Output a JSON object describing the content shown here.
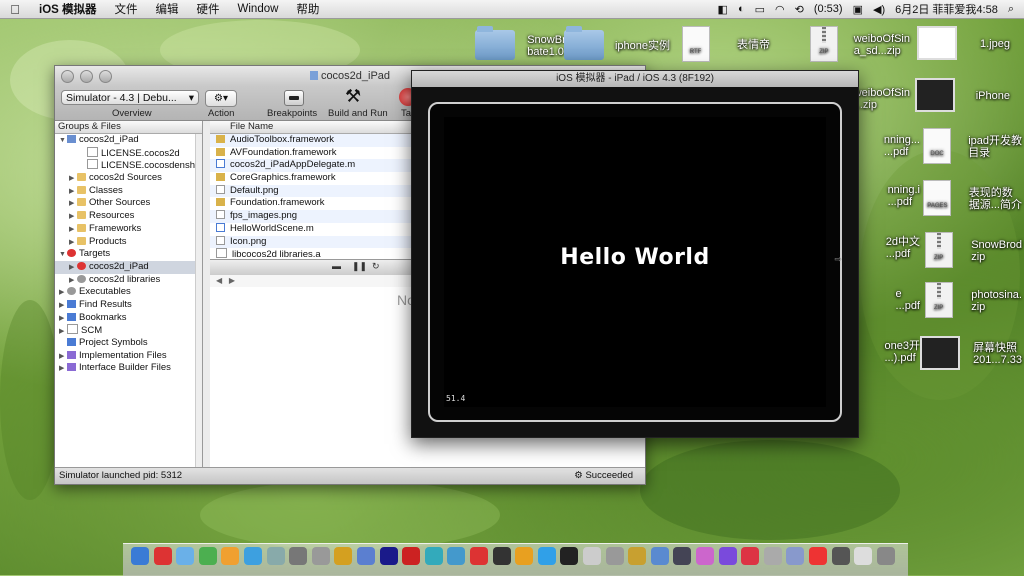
{
  "menubar": {
    "apple": "",
    "app_name": "iOS 模拟器",
    "items": [
      "文件",
      "编辑",
      "硬件",
      "Window",
      "帮助"
    ],
    "status": {
      "battery": "(0:53)",
      "clock": "6月2日 菲菲爱我4:58"
    }
  },
  "desktop_icons": [
    {
      "label": "SnowBrod\nbate1.0 2",
      "kind": "folder"
    },
    {
      "label": "iphone实例",
      "kind": "folder"
    },
    {
      "label": "表情帝",
      "kind": "doc",
      "badge": "RTF"
    },
    {
      "label": "weiboOfSin\na_sd...zip",
      "kind": "zip",
      "badge": "ZIP"
    },
    {
      "label": "1.jpeg",
      "kind": "thumb"
    },
    {
      "label": "weiboOfSin\n...zip",
      "kind": "zip",
      "badge": "ZIP"
    },
    {
      "label": "iPhone",
      "kind": "thumb"
    },
    {
      "label": "nning...\n...pdf",
      "kind": "pdf"
    },
    {
      "label": "ipad开发教\n目录",
      "kind": "doc",
      "badge": "DOC"
    },
    {
      "label": "nning.i\n...pdf",
      "kind": "pdf"
    },
    {
      "label": "表现的数\n据源...简介",
      "kind": "doc",
      "badge": "PAGES"
    },
    {
      "label": "2d中文\n...pdf",
      "kind": "pdf"
    },
    {
      "label": "SnowBrod\nzip",
      "kind": "zip",
      "badge": "ZIP"
    },
    {
      "label": "e\n...pdf",
      "kind": "pdf"
    },
    {
      "label": "photosina.\nzip",
      "kind": "zip",
      "badge": "ZIP"
    },
    {
      "label": "one3开\n...).pdf",
      "kind": "pdf"
    },
    {
      "label": "屏幕快照\n201...7.33",
      "kind": "thumb"
    }
  ],
  "xcode": {
    "title": "cocos2d_iPad",
    "scheme_popup": "Simulator - 4.3 | Debu...",
    "toolbar_labels": {
      "overview": "Overview",
      "action": "Action",
      "breakpoints": "Breakpoints",
      "build_and_run": "Build and Run",
      "tasks": "Ta"
    },
    "groups_header": "Groups & Files",
    "tree": [
      {
        "label": "cocos2d_iPad",
        "level": 0,
        "tri": "▼",
        "icon": "proj"
      },
      {
        "label": "LICENSE.cocos2d",
        "level": 2,
        "tri": "",
        "icon": "file"
      },
      {
        "label": "LICENSE.cocosdenshion",
        "level": 2,
        "tri": "",
        "icon": "file"
      },
      {
        "label": "cocos2d Sources",
        "level": 1,
        "tri": "▶",
        "icon": "fold"
      },
      {
        "label": "Classes",
        "level": 1,
        "tri": "▶",
        "icon": "fold"
      },
      {
        "label": "Other Sources",
        "level": 1,
        "tri": "▶",
        "icon": "fold"
      },
      {
        "label": "Resources",
        "level": 1,
        "tri": "▶",
        "icon": "fold"
      },
      {
        "label": "Frameworks",
        "level": 1,
        "tri": "▶",
        "icon": "fold"
      },
      {
        "label": "Products",
        "level": 1,
        "tri": "▶",
        "icon": "fold"
      },
      {
        "label": "Targets",
        "level": 0,
        "tri": "▼",
        "icon": "target"
      },
      {
        "label": "cocos2d_iPad",
        "level": 1,
        "tri": "▶",
        "icon": "target",
        "selected": true
      },
      {
        "label": "cocos2d libraries",
        "level": 1,
        "tri": "▶",
        "icon": "gear"
      },
      {
        "label": "Executables",
        "level": 0,
        "tri": "▶",
        "icon": "gear"
      },
      {
        "label": "Find Results",
        "level": 0,
        "tri": "▶",
        "icon": "blue"
      },
      {
        "label": "Bookmarks",
        "level": 0,
        "tri": "▶",
        "icon": "blue"
      },
      {
        "label": "SCM",
        "level": 0,
        "tri": "▶",
        "icon": "file"
      },
      {
        "label": "Project Symbols",
        "level": 0,
        "tri": "",
        "icon": "blue"
      },
      {
        "label": "Implementation Files",
        "level": 0,
        "tri": "▶",
        "icon": "purple"
      },
      {
        "label": "Interface Builder Files",
        "level": 0,
        "tri": "▶",
        "icon": "purple"
      }
    ],
    "files_header": "File Name",
    "files": [
      {
        "name": "AudioToolbox.framework",
        "icon": "fw"
      },
      {
        "name": "AVFoundation.framework",
        "icon": "fw"
      },
      {
        "name": "cocos2d_iPadAppDelegate.m",
        "icon": "m"
      },
      {
        "name": "CoreGraphics.framework",
        "icon": "fw"
      },
      {
        "name": "Default.png",
        "icon": "png"
      },
      {
        "name": "Foundation.framework",
        "icon": "fw"
      },
      {
        "name": "fps_images.png",
        "icon": "png"
      },
      {
        "name": "HelloWorldScene.m",
        "icon": "m"
      },
      {
        "name": "Icon.png",
        "icon": "png"
      },
      {
        "name": "libcocos2d libraries.a",
        "icon": "file"
      }
    ],
    "editor_placeholder": "No",
    "status_left": "Simulator launched pid: 5312",
    "status_right": "Succeeded"
  },
  "simulator": {
    "title": "iOS 模拟器 - iPad / iOS 4.3 (8F192)",
    "screen_text": "Hello World",
    "fps": "51.4"
  },
  "dock_count": 34
}
